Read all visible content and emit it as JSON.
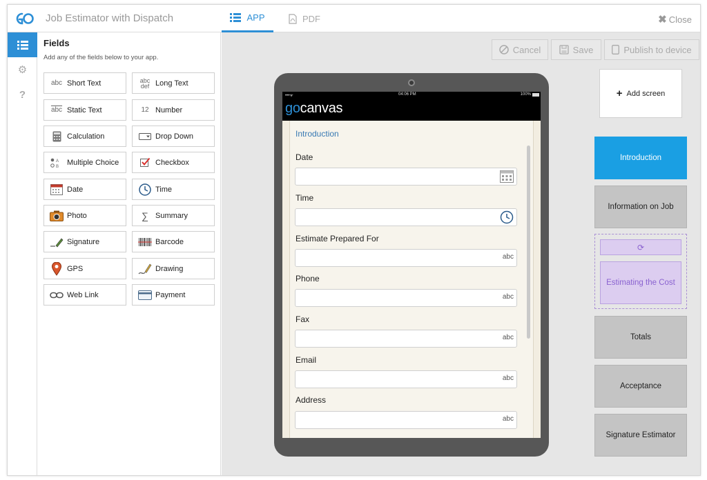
{
  "header": {
    "app_title": "Job Estimator with Dispatch",
    "tabs": [
      {
        "label": "APP"
      },
      {
        "label": "PDF"
      }
    ],
    "close_label": "Close"
  },
  "fields_panel": {
    "title": "Fields",
    "subtitle": "Add any of the fields below to your app.",
    "items": [
      {
        "label": "Short Text",
        "icon": "abc-text-icon"
      },
      {
        "label": "Long Text",
        "icon": "abc-def-text-icon"
      },
      {
        "label": "Static Text",
        "icon": "static-text-icon"
      },
      {
        "label": "Number",
        "icon": "number-icon"
      },
      {
        "label": "Calculation",
        "icon": "calculator-icon"
      },
      {
        "label": "Drop Down",
        "icon": "dropdown-icon"
      },
      {
        "label": "Multiple Choice",
        "icon": "multiple-choice-icon"
      },
      {
        "label": "Checkbox",
        "icon": "checkbox-icon"
      },
      {
        "label": "Date",
        "icon": "calendar-icon"
      },
      {
        "label": "Time",
        "icon": "clock-icon"
      },
      {
        "label": "Photo",
        "icon": "camera-icon"
      },
      {
        "label": "Summary",
        "icon": "sigma-icon"
      },
      {
        "label": "Signature",
        "icon": "signature-icon"
      },
      {
        "label": "Barcode",
        "icon": "barcode-icon"
      },
      {
        "label": "GPS",
        "icon": "map-pin-icon"
      },
      {
        "label": "Drawing",
        "icon": "drawing-icon"
      },
      {
        "label": "Web Link",
        "icon": "link-icon"
      },
      {
        "label": "Payment",
        "icon": "credit-card-icon"
      }
    ],
    "icon_text": {
      "abc": "abc",
      "abc_top": "abc",
      "abc_bottom": "def",
      "number": "12"
    }
  },
  "toolbar": {
    "cancel_label": "Cancel",
    "save_label": "Save",
    "publish_label": "Publish to device"
  },
  "tablet": {
    "status_time": "04:06 PM",
    "battery": "100%",
    "brand_go": "go",
    "brand_rest": "canvas",
    "form_title": "Introduction",
    "fields": [
      {
        "label": "Date",
        "type": "date"
      },
      {
        "label": "Time",
        "type": "time"
      },
      {
        "label": "Estimate Prepared For",
        "type": "text",
        "hint": "abc"
      },
      {
        "label": "Phone",
        "type": "text",
        "hint": "abc"
      },
      {
        "label": "Fax",
        "type": "text",
        "hint": "abc"
      },
      {
        "label": "Email",
        "type": "text",
        "hint": "abc"
      },
      {
        "label": "Address",
        "type": "text",
        "hint": "abc"
      }
    ]
  },
  "screens": {
    "add_label": "Add screen",
    "items": [
      {
        "label": "Introduction",
        "state": "active"
      },
      {
        "label": "Information on Job",
        "state": "normal"
      },
      {
        "label": "Estimating the Cost",
        "state": "linked"
      },
      {
        "label": "Totals",
        "state": "normal"
      },
      {
        "label": "Acceptance",
        "state": "normal"
      },
      {
        "label": "Signature Estimator",
        "state": "normal"
      }
    ]
  },
  "colors": {
    "accent": "#2d8fd6",
    "active_screen": "#1a9fe3",
    "linked_screen": "#dccdf0",
    "canvas_bg": "#e6e6e6"
  }
}
